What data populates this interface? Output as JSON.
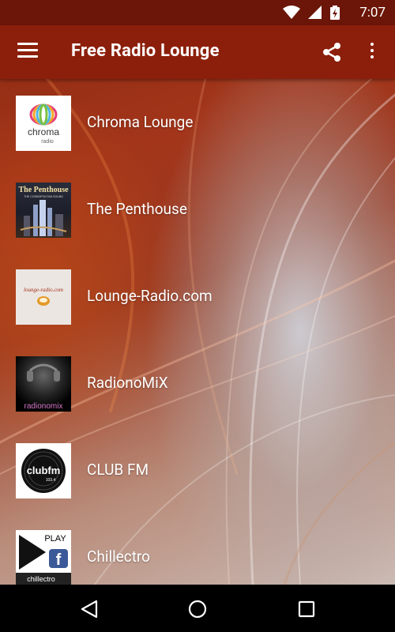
{
  "status_bar": {
    "time": "7:07"
  },
  "app_bar": {
    "title": "Free Radio Lounge"
  },
  "stations": [
    {
      "name": "Chroma Lounge",
      "logo_text": "chroma",
      "logo_sub": "radio"
    },
    {
      "name": "The Penthouse",
      "logo_text": "The Penthouse",
      "logo_sub": "THE COSMOPOLITAN SOUND"
    },
    {
      "name": "Lounge-Radio.com",
      "logo_text": "lounge-radio.com"
    },
    {
      "name": "RadionoMiX",
      "logo_text": "radionomix"
    },
    {
      "name": "CLUB FM",
      "logo_text": "clubfm",
      "logo_sub": "103.4"
    },
    {
      "name": "Chillectro",
      "logo_text": "chillectro",
      "logo_sub": "PLAY"
    }
  ],
  "colors": {
    "app_bar": "#8c1f0b",
    "status_bar": "#6b1608",
    "nav_bar": "#000000"
  }
}
